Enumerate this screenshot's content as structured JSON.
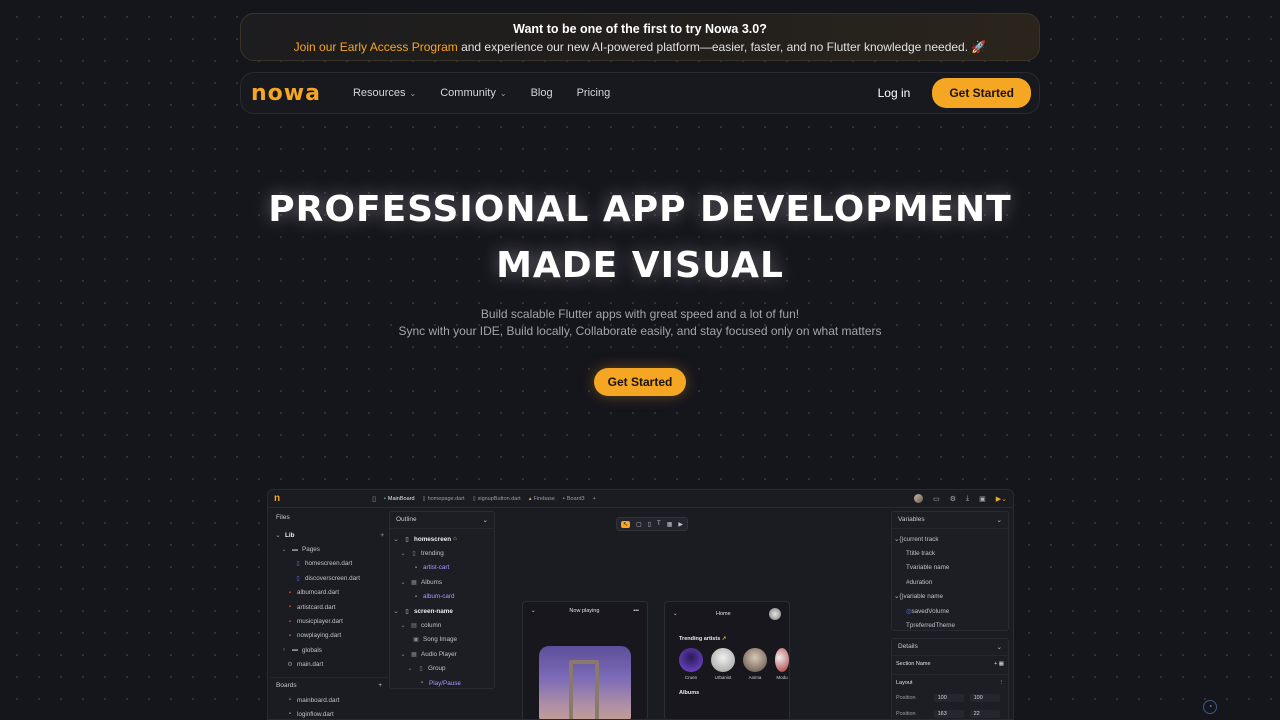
{
  "banner": {
    "title": "Want to be one of the first to try Nowa 3.0?",
    "link": "Join our Early Access Program",
    "rest": " and experience our new AI-powered platform—easier, faster, and no Flutter knowledge needed. 🚀"
  },
  "nav": {
    "logo": "nowa",
    "items": [
      "Resources",
      "Community",
      "Blog",
      "Pricing"
    ],
    "login": "Log in",
    "cta": "Get Started"
  },
  "hero": {
    "title_line1": "PROFESSIONAL APP DEVELOPMENT",
    "title_line2": "MADE VISUAL",
    "sub1": "Build scalable Flutter apps with great speed and a lot of fun!",
    "sub2": "Sync with your IDE, Build locally, Collaborate easily, and stay focused only on what matters",
    "cta": "Get Started"
  },
  "ide": {
    "logo": "n",
    "tabs": [
      "MainBoard",
      "homepage.dart",
      "signupButton.dart",
      "Firebase",
      "Board3",
      "+"
    ],
    "files": {
      "header": "Files",
      "rows": [
        "Lib",
        "Pages",
        "homescreen.dart",
        "discoverscreen.dart",
        "albumcard.dart",
        "artistcard.dart",
        "musicplayer.dart",
        "nowplaying.dart",
        "globals",
        "main.dart"
      ],
      "boards_header": "Boards",
      "boards": [
        "mainboard.dart",
        "loginflow.dart"
      ]
    },
    "outline": {
      "header": "Outline",
      "rows": [
        "homescreen",
        "trending",
        "artist-cart",
        "Albums",
        "album-card",
        "screen-name",
        "column",
        "Song Image",
        "Audio Player",
        "Group",
        "Play/Pause"
      ]
    },
    "phone1": {
      "title": "Now playing"
    },
    "phone2": {
      "title": "Home",
      "trending": "Trending artists",
      "artists": [
        "Cruen",
        "Urbanist",
        "Anima",
        "Modu"
      ],
      "albums": "Albums"
    },
    "variables": {
      "header": "Variables",
      "rows": [
        "current track",
        "title track",
        "variable name",
        "duration",
        "variable name",
        "savedVolume",
        "preferredTheme"
      ]
    },
    "details": {
      "header": "Details",
      "section": "Section Name",
      "layout": "Layout",
      "position_label": "Position",
      "values": [
        "100",
        "100",
        "163",
        "22"
      ]
    }
  }
}
